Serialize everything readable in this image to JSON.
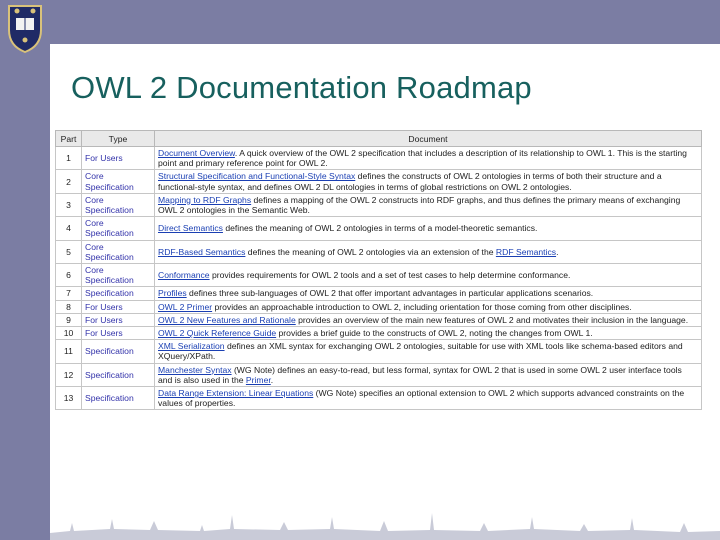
{
  "title": "OWL 2 Documentation Roadmap",
  "table": {
    "headers": [
      "Part",
      "Type",
      "Document"
    ],
    "rows": [
      {
        "part": "1",
        "type": "For Users",
        "link": "Document Overview",
        "text": ". A quick overview of the OWL 2 specification that includes a description of its relationship to OWL 1. This is the starting point and primary reference point for OWL 2."
      },
      {
        "part": "2",
        "type": "Core Specification",
        "link": "Structural Specification and Functional-Style Syntax",
        "text": " defines the constructs of OWL 2 ontologies in terms of both their structure and a functional-style syntax, and defines OWL 2 DL ontologies in terms of global restrictions on OWL 2 ontologies."
      },
      {
        "part": "3",
        "type": "Core Specification",
        "link": "Mapping to RDF Graphs",
        "text": " defines a mapping of the OWL 2 constructs into RDF graphs, and thus defines the primary means of exchanging OWL 2 ontologies in the Semantic Web."
      },
      {
        "part": "4",
        "type": "Core Specification",
        "link": "Direct Semantics",
        "text": " defines the meaning of OWL 2 ontologies in terms of a model-theoretic semantics."
      },
      {
        "part": "5",
        "type": "Core Specification",
        "link": "RDF-Based Semantics",
        "text": " defines the meaning of OWL 2 ontologies via an extension of the ",
        "link2": "RDF Semantics",
        "text2": "."
      },
      {
        "part": "6",
        "type": "Core Specification",
        "link": "Conformance",
        "text": " provides requirements for OWL 2 tools and a set of test cases to help determine conformance."
      },
      {
        "part": "7",
        "type": "Specification",
        "link": "Profiles",
        "text": " defines three sub-languages of OWL 2 that offer important advantages in particular applications scenarios."
      },
      {
        "part": "8",
        "type": "For Users",
        "link": "OWL 2 Primer",
        "text": " provides an approachable introduction to OWL 2, including orientation for those coming from other disciplines."
      },
      {
        "part": "9",
        "type": "For Users",
        "link": "OWL 2 New Features and Rationale",
        "text": " provides an overview of the main new features of OWL 2 and motivates their inclusion in the language."
      },
      {
        "part": "10",
        "type": "For Users",
        "link": "OWL 2 Quick Reference Guide",
        "text": " provides a brief guide to the constructs of OWL 2, noting the changes from OWL 1."
      },
      {
        "part": "11",
        "type": "Specification",
        "link": "XML Serialization",
        "text": " defines an XML syntax for exchanging OWL 2 ontologies, suitable for use with XML tools like schema-based editors and XQuery/XPath."
      },
      {
        "part": "12",
        "type": "Specification",
        "link": "Manchester Syntax",
        "text": " (WG Note) defines an easy-to-read, but less formal, syntax for OWL 2 that is used in some OWL 2 user interface tools and is also used in the ",
        "link2": "Primer",
        "text2": "."
      },
      {
        "part": "13",
        "type": "Specification",
        "link": "Data Range Extension: Linear Equations",
        "text": " (WG Note) specifies an optional extension to OWL 2 which supports advanced constraints on the values of properties."
      }
    ]
  }
}
